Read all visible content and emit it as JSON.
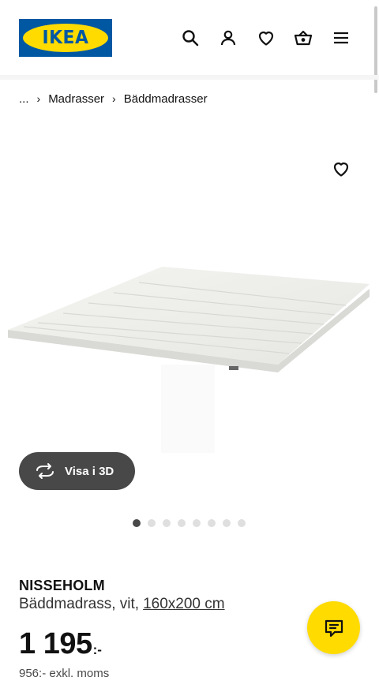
{
  "header": {
    "logo_text": "IKEA",
    "icons": [
      "search-icon",
      "account-icon",
      "heart-icon",
      "cart-icon",
      "menu-icon"
    ]
  },
  "breadcrumb": {
    "ellipsis": "...",
    "items": [
      "Madrasser",
      "Bäddmadrasser"
    ]
  },
  "product": {
    "name": "NISSEHOLM",
    "description": "Bäddmadrass, vit,",
    "size": "160x200 cm",
    "price_value": "1 195",
    "price_currency": ":-",
    "price_excl_vat": "956:- exkl. moms"
  },
  "gallery": {
    "view_3d_label": "Visa i 3D",
    "image_count": 8,
    "active_index": 0
  },
  "colors": {
    "brand_blue": "#0058a3",
    "brand_yellow": "#ffdb00",
    "dark_button": "#484848"
  }
}
